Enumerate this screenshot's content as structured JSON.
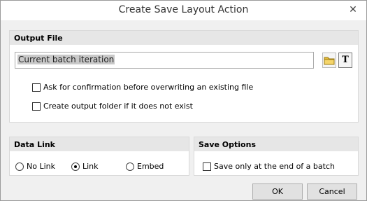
{
  "window": {
    "title": "Create Save Layout Action"
  },
  "output_file": {
    "header": "Output File",
    "value": "Current batch iteration",
    "confirm_overwrite_label": "Ask for confirmation before overwriting an existing file",
    "create_folder_label": "Create output folder if it does not exist",
    "confirm_overwrite_checked": false,
    "create_folder_checked": false
  },
  "data_link": {
    "header": "Data Link",
    "options": [
      "No Link",
      "Link",
      "Embed"
    ],
    "selected": "Link"
  },
  "save_options": {
    "header": "Save Options",
    "save_end_label": "Save only at the end of a batch",
    "save_end_checked": false
  },
  "buttons": {
    "ok": "OK",
    "cancel": "Cancel"
  },
  "icons": {
    "close": "close-icon",
    "folder": "folder-icon",
    "text": "text-icon"
  },
  "colors": {
    "folder": "#e2b93b"
  }
}
